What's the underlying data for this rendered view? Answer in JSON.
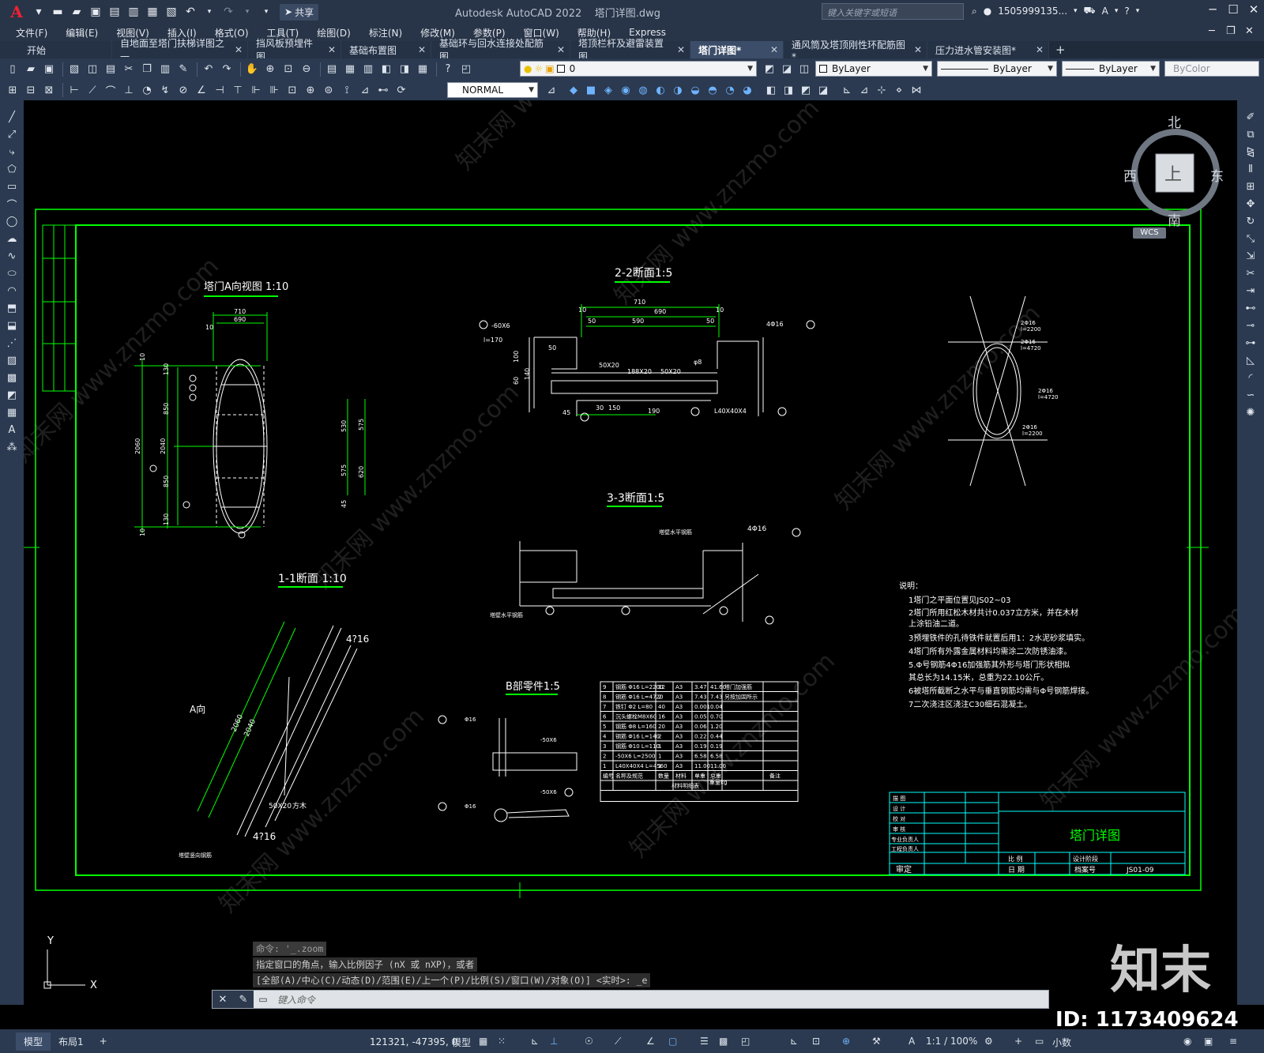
{
  "app": {
    "title": "Autodesk AutoCAD 2022",
    "document": "塔门详图.dwg",
    "logo": "A",
    "share_label": "共享",
    "search_placeholder": "键入关键字或短语",
    "user": "1505999135...",
    "colors": {
      "titlebar": "#283447",
      "canvas": "#000000",
      "frame": "#00ff00",
      "accent": "#3b4d69"
    }
  },
  "menu": [
    "文件(F)",
    "编辑(E)",
    "视图(V)",
    "插入(I)",
    "格式(O)",
    "工具(T)",
    "绘图(D)",
    "标注(N)",
    "修改(M)",
    "参数(P)",
    "窗口(W)",
    "帮助(H)",
    "Express"
  ],
  "tabs": [
    {
      "label": "开始",
      "active": false
    },
    {
      "label": "自地面至塔门扶梯详图之一",
      "active": false
    },
    {
      "label": "挡风板预埋件图",
      "active": false
    },
    {
      "label": "基础布置图",
      "active": false
    },
    {
      "label": "基础环与回水连接处配筋图",
      "active": false
    },
    {
      "label": "塔顶栏杆及避雷装置图",
      "active": false
    },
    {
      "label": "塔门详图*",
      "active": true
    },
    {
      "label": "通风筒及塔顶刚性环配筋图*",
      "active": false
    },
    {
      "label": "压力进水管安装图*",
      "active": false
    }
  ],
  "toolbar": {
    "layer_value": "0",
    "dimstyle_value": "NORMAL",
    "color_value": "ByLayer",
    "linetype_value": "ByLayer",
    "lineweight_value": "ByLayer",
    "plotstyle_value": "ByColor"
  },
  "viewcube": {
    "north": "北",
    "south": "南",
    "east": "东",
    "west": "西",
    "top": "上",
    "wcs": "WCS"
  },
  "drawing": {
    "titles": {
      "view_a": "塔门A向视图 1:10",
      "sec22": "2-2断面1:5",
      "sec33": "3-3断面1:5",
      "sec11": "1-1断面 1:10",
      "part_b": "B部零件1:5",
      "dir_a": "A向"
    },
    "view_a_dims": {
      "w_outer": "710",
      "w_inner": "690",
      "h_total": "2060",
      "h_inner": "2040",
      "h_upper": "850",
      "h_lower": "850",
      "r1": "530",
      "r2": "575",
      "r3": "575",
      "r4": "620",
      "top": "10",
      "gap1": "130",
      "gap2": "130",
      "bottom": "10",
      "small": "45"
    },
    "sec22_dims": {
      "total": "710",
      "inner": "690",
      "a": "50",
      "b": "590",
      "c": "50",
      "side1": "10",
      "side2": "10",
      "bar": "4Φ16",
      "plate": "-60X6",
      "plate_l": "l=170",
      "f1": "50X20",
      "f2": "188X20",
      "f3": "50X20",
      "angle": "L40X40X4",
      "d60": "60",
      "d100": "100",
      "d140": "140",
      "d45": "45",
      "d30": "30",
      "d150": "150",
      "d190": "190",
      "d8": "φ8"
    },
    "sec33_labels": {
      "bar": "4Φ16",
      "top_rebar": "塔壁水平钢筋",
      "bot_rebar": "塔壁水平钢筋"
    },
    "sec11_labels": {
      "bar_top": "4?16",
      "bar_bot": "4?16",
      "d2060": "2060",
      "d2040": "2040",
      "flat": "50X20",
      "flat_label": "方木",
      "bottom_label": "塔壁竖向钢筋",
      "dim_a": "A向"
    },
    "right_detail": {
      "l1": "2Φ16",
      "l1b": "l=2200",
      "l2": "2Φ16",
      "l2b": "l=4720",
      "l3": "2Φ16",
      "l3b": "l=4720",
      "l4": "2Φ16",
      "l4b": "l=2200"
    },
    "notes": {
      "heading": "说明：",
      "items": [
        "1塔门之平面位置见JS02~03",
        "2塔门所用红松木材共计0.037立方米，并在木材",
        "  上涂铅油二道。",
        "3预埋铁件的孔待铁件就置后用1：2水泥砂浆填实。",
        "4塔门所有外露金属材料均需涂二次防锈油漆。",
        "5.Φ号钢筋4Φ16加强筋其外形与塔门形状相似",
        "  其总长为14.15米，总重为22.10公斤。",
        "6被塔所截断之水平与垂直钢筋均需与Φ号钢筋焊接。",
        "7二次浇注区浇注C30细石混凝土。"
      ]
    },
    "material_table": {
      "rows": [
        [
          "9",
          "钢筋 Φ16 L=2200",
          "12",
          "A3",
          "3.47",
          "41.60",
          "塔门加强筋"
        ],
        [
          "8",
          "钢筋 Φ16 L=4720",
          "2",
          "A3",
          "7.43",
          "7.43",
          "另按加固所示"
        ],
        [
          "7",
          "铁钉 Φ2 L=80",
          "40",
          "A3",
          "0.001",
          "0.04",
          ""
        ],
        [
          "6",
          "沉头螺栓M8X60",
          "16",
          "A3",
          "0.05",
          "0.70",
          ""
        ],
        [
          "5",
          "钢筋 Φ8 L=160",
          "20",
          "A3",
          "0.06",
          "1.20",
          ""
        ],
        [
          "4",
          "钢筋 Φ16 L=140",
          "2",
          "A3",
          "0.22",
          "0.44",
          ""
        ],
        [
          "3",
          "钢筋 Φ10 L=110",
          "1",
          "A3",
          "0.19",
          "0.19",
          ""
        ],
        [
          "2",
          "-50X6 L=2500",
          "1",
          "A3",
          "6.58",
          "6.58",
          ""
        ],
        [
          "1",
          "L40X40X4 L=4560",
          "1",
          "A3",
          "11.00",
          "11.00",
          ""
        ]
      ],
      "header": [
        "编号",
        "名称及规范",
        "数量",
        "材料",
        "单重",
        "总重",
        "备注"
      ],
      "footer": "材料明细表",
      "weight_unit": "重量kg"
    },
    "part_b": {
      "p1": "Φ16",
      "p2": "-50X6",
      "p3": "Φ16",
      "p4": "-50X6"
    },
    "title_block": {
      "rows": [
        "描 图",
        "设 计",
        "校 对",
        "审 核",
        "专业负责人",
        "工程负责人"
      ],
      "approve": "审定",
      "scale_label": "比 例",
      "date_label": "日 期",
      "stage_label": "设计阶段",
      "archive_label": "档案号",
      "archive_no": "JS01-09",
      "drawing_title": "塔门详图"
    }
  },
  "ucs": {
    "x": "X",
    "y": "Y"
  },
  "watermark": {
    "brand": "知末",
    "id": "ID: 1173409624",
    "site": "知末网 www.znzmo.com"
  },
  "command": {
    "history": [
      "命令: '_.zoom",
      "指定窗口的角点，输入比例因子 (nX 或 nXP)，或者",
      "[全部(A)/中心(C)/动态(D)/范围(E)/上一个(P)/比例(S)/窗口(W)/对象(O)] <实时>: _e"
    ],
    "placeholder": "键入命令"
  },
  "status": {
    "layout_tabs": [
      "模型",
      "布局1"
    ],
    "coords": "121321, -47395, 0",
    "mode": "模型",
    "scale": "1:1 / 100%",
    "units": "小数"
  }
}
